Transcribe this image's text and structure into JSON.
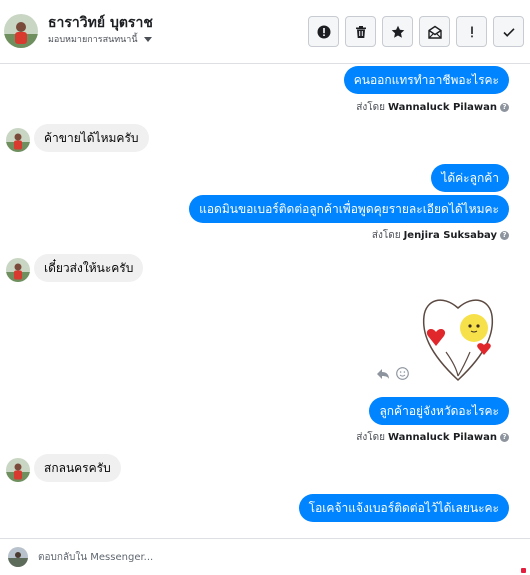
{
  "header": {
    "name": "ธาราวิทย์ บุตราช",
    "assign_label": "มอบหมายการสนทนานี้"
  },
  "toolbar": [
    {
      "name": "mark-spam-button",
      "icon": "exclamation-circle-icon"
    },
    {
      "name": "delete-button",
      "icon": "trash-icon"
    },
    {
      "name": "star-button",
      "icon": "star-icon"
    },
    {
      "name": "mark-unread-button",
      "icon": "envelope-open-icon"
    },
    {
      "name": "follow-up-button",
      "icon": "exclamation-icon"
    },
    {
      "name": "mark-done-button",
      "icon": "checkmark-icon"
    }
  ],
  "messages": {
    "m1": "คนออกแทรทำอาชีพอะไรคะ",
    "m1_sentby_prefix": "ส่งโดย",
    "m1_sender": "Wannaluck Pilawan",
    "m2": "ค้าขายได้ไหมครับ",
    "m3": "ได้ค่ะลูกค้า",
    "m4": "แอดมินขอเบอร์ติดต่อลูกค้าเพื่อพูดคุยรายละเอียดได้ไหมคะ",
    "m4_sentby_prefix": "ส่งโดย",
    "m4_sender": "Jenjira Suksabay",
    "m5": "เดี๋ยวส่งให้นะครับ",
    "m6": "ลูกค้าอยู่จังหวัดอะไรคะ",
    "m6_sentby_prefix": "ส่งโดย",
    "m6_sender": "Wannaluck Pilawan",
    "m7": "สกลนครครับ",
    "m8": "โอเคจ้าแจ้งเบอร์ติดต่อไว้ได้เลยนะคะ"
  },
  "composer": {
    "placeholder": "ตอบกลับใน Messenger..."
  },
  "colors": {
    "outgoing": "#0084ff",
    "incoming": "#f1f0f0"
  }
}
